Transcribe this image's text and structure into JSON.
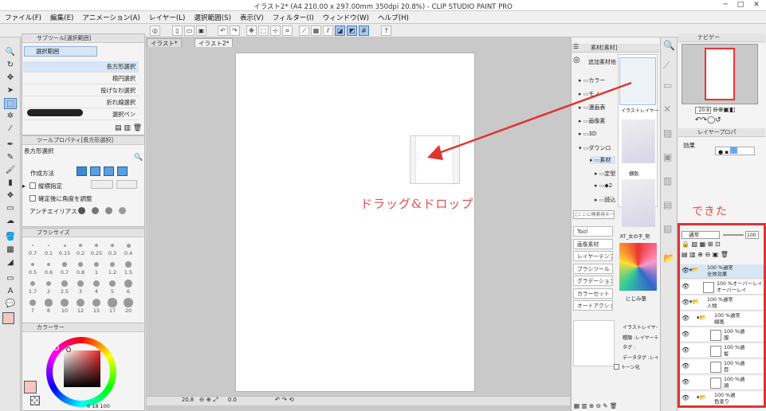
{
  "window": {
    "title": "イラスト2* (A4 210.00 x 297.00mm 350dpi 20.8%) - CLIP STUDIO PAINT PRO",
    "minimize": "─",
    "maximize": "□",
    "close": "✕"
  },
  "menu": [
    "ファイル(F)",
    "編集(E)",
    "アニメーション(A)",
    "レイヤー(L)",
    "選択範囲(S)",
    "表示(V)",
    "フィルター(I)",
    "ウィンドウ(W)",
    "ヘルプ(H)"
  ],
  "canvas_tabs": [
    "イラスト*",
    "イラスト2*"
  ],
  "subtool": {
    "header": "サブツール[選択範囲]",
    "group": "選択範囲",
    "items": [
      "長方形選択",
      "楕円選択",
      "投げなわ選択",
      "折れ線選択",
      "選択ペン"
    ]
  },
  "toolprop": {
    "header": "ツールプロパティ[長方形選択]",
    "name": "長方形選択",
    "mode_label": "作成方法",
    "ratio_label": "縦横指定",
    "angle_label": "確定後に角度を調整",
    "aa_label": "アンチエイリアス"
  },
  "brushsize": {
    "header": "ブラシサイズ",
    "rows": [
      [
        "0.7",
        "0.1",
        "0.15",
        "0.2",
        "0.25",
        "0.3",
        "0.4"
      ],
      [
        "0.5",
        "0.6",
        "0.7",
        "0.8",
        "1",
        "1.2",
        "1.5"
      ],
      [
        "1.7",
        "2",
        "2.5",
        "3",
        "4",
        "5",
        "6"
      ],
      [
        "7",
        "8",
        "10",
        "12",
        "15",
        "17",
        "20"
      ]
    ]
  },
  "colorwheel": {
    "header": "カラーサー",
    "readout": "6 18 100"
  },
  "canvas": {
    "zoom": "20.8",
    "angle": "0.0"
  },
  "annotation": {
    "drag_drop": "ドラッグ&ドロップ",
    "done": "できた"
  },
  "materials": {
    "header": "素材[素材]",
    "add_label": "追加素材他",
    "search_placeholder": "[ここに検索用キー",
    "tree": [
      "カラー",
      "モノ",
      "漫画表",
      "画像素",
      "3D",
      "ダウンロ",
      "素材",
      "定型",
      "◆2",
      "読込"
    ],
    "tags": [
      "Tool",
      "画像素材",
      "レイヤーテンプ",
      "ブラシツール",
      "グラデーション",
      "カラーセット",
      "オートアクション"
    ],
    "thumb_labels": [
      "イラストレイヤー",
      "横臥",
      "RT_女の子_制",
      "にじみ筆"
    ],
    "detail": [
      "イラストレイヤーテ",
      "種類 :レイヤーテ",
      "タグ :",
      "データタグ :レイヤ",
      "トーン化"
    ]
  },
  "navigator": {
    "header": "ナビゲー",
    "zoom": "20.8"
  },
  "layerprop": {
    "header": "レイヤープロパ",
    "effect_label": "効果"
  },
  "layers": {
    "blend_mode": "通常",
    "opacity": "100",
    "items": [
      {
        "line1": "100 %通常",
        "line2": "全体効果",
        "depth": 0,
        "type": "folder"
      },
      {
        "line1": "100 %オーバーレイ",
        "line2": "オーバーレイ",
        "depth": 1,
        "type": "layer"
      },
      {
        "line1": "100 %通常",
        "line2": "人物",
        "depth": 0,
        "type": "folder"
      },
      {
        "line1": "100 %通常",
        "line2": "線画",
        "depth": 1,
        "type": "folder"
      },
      {
        "line1": "100 %通",
        "line2": "服",
        "depth": 2,
        "type": "layer"
      },
      {
        "line1": "100 %通",
        "line2": "髪",
        "depth": 2,
        "type": "layer"
      },
      {
        "line1": "100 %通",
        "line2": "目",
        "depth": 2,
        "type": "layer"
      },
      {
        "line1": "100 %通",
        "line2": "顔",
        "depth": 2,
        "type": "layer"
      },
      {
        "line1": "100 %通",
        "line2": "色塗り",
        "depth": 1,
        "type": "folder"
      }
    ]
  },
  "colors": {
    "accent": "#a8c8ef",
    "annotation_red": "#e03333",
    "main_color": "#f4c6c1"
  }
}
